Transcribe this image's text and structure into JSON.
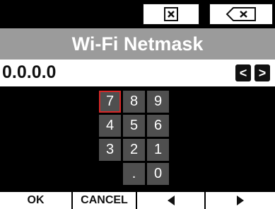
{
  "top_buttons": {
    "close_icon": "x-box-icon",
    "backspace_icon": "backspace-icon"
  },
  "title": "Wi-Fi Netmask",
  "value": "0.0.0.0",
  "cursor_buttons": {
    "left_label": "<",
    "right_label": ">"
  },
  "keypad": {
    "selected": "7",
    "rows": [
      [
        "7",
        "8",
        "9"
      ],
      [
        "4",
        "5",
        "6"
      ],
      [
        "3",
        "2",
        "1"
      ],
      [
        "",
        ".",
        "0"
      ]
    ]
  },
  "softkeys": {
    "ok": "OK",
    "cancel": "CANCEL",
    "prev_icon": "triangle-left-icon",
    "next_icon": "triangle-right-icon"
  },
  "colors": {
    "title_bar": "#9b9b9b",
    "key_bg": "#4f4f4f",
    "selected_border": "#d62828"
  }
}
